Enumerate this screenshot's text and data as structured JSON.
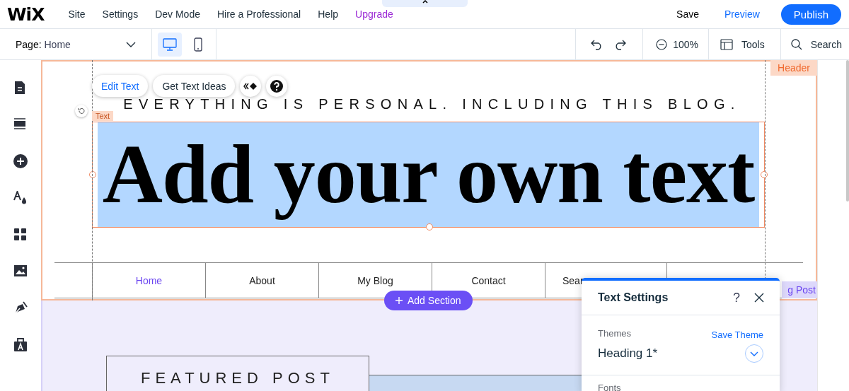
{
  "top_menu": {
    "logo": "WiX",
    "items": [
      {
        "label": "Site",
        "kind": "menu"
      },
      {
        "label": "Settings",
        "kind": "menu"
      },
      {
        "label": "Dev Mode",
        "kind": "menu"
      },
      {
        "label": "Hire a Professional",
        "kind": "menu"
      },
      {
        "label": "Help",
        "kind": "menu"
      },
      {
        "label": "Upgrade",
        "kind": "upgrade"
      }
    ],
    "save": "Save",
    "preview": "Preview",
    "publish": "Publish"
  },
  "toolbar": {
    "page_label": "Page:",
    "page_value": "Home",
    "devices": [
      {
        "kind": "desktop",
        "selected": true
      },
      {
        "kind": "mobile",
        "selected": false
      }
    ],
    "zoom": "100%",
    "tools": "Tools",
    "search": "Search"
  },
  "canvas": {
    "header_label": "Header",
    "text_toolbar": {
      "edit": "Edit Text",
      "ideas": "Get Text Ideas"
    },
    "selection_tag": "Text",
    "tagline": "EVERYTHING IS PERSONAL. INCLUDING THIS BLOG.",
    "heading": "Add your own text",
    "nav": [
      {
        "label": "Home",
        "selected": true
      },
      {
        "label": "About",
        "selected": false
      },
      {
        "label": "My Blog",
        "selected": false
      },
      {
        "label": "Contact",
        "selected": false
      },
      {
        "label": "Sear",
        "selected": false
      }
    ],
    "add_section": "Add Section",
    "section_label": "g Post",
    "featured": "FEATURED POST"
  },
  "text_settings": {
    "title": "Text Settings",
    "help": "?",
    "themes_label": "Themes",
    "save_theme": "Save Theme",
    "theme_value": "Heading 1*",
    "fonts_label": "Fonts"
  }
}
